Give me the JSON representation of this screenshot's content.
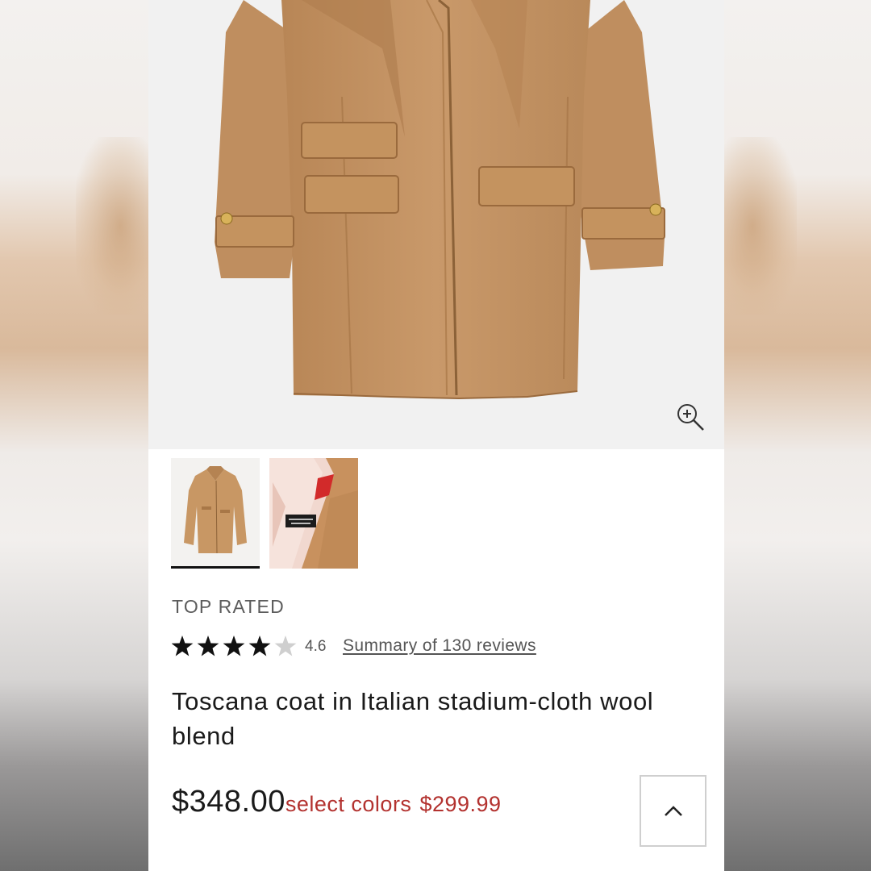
{
  "product": {
    "badge": "TOP RATED",
    "rating": {
      "value_label": "4.6",
      "value": 4.6,
      "max": 5,
      "reviews_link": "Summary of 130 reviews"
    },
    "title": "Toscana coat in Italian stadium-cloth wool blend",
    "price": "$348.00",
    "sale": {
      "label": "select colors",
      "price": "$299.99"
    }
  },
  "gallery": {
    "selected_index": 0,
    "thumbnails": [
      {
        "icon": "coat-front-thumbnail"
      },
      {
        "icon": "coat-lining-thumbnail",
        "label_text": "J.CREW COLLECTION"
      }
    ]
  },
  "icons": {
    "zoom": "zoom-in-icon",
    "back_to_top": "chevron-up-icon",
    "star": "star-icon"
  },
  "colors": {
    "camel": "#c49466",
    "sale_red": "#b3322f",
    "text": "#1a1a1a"
  }
}
